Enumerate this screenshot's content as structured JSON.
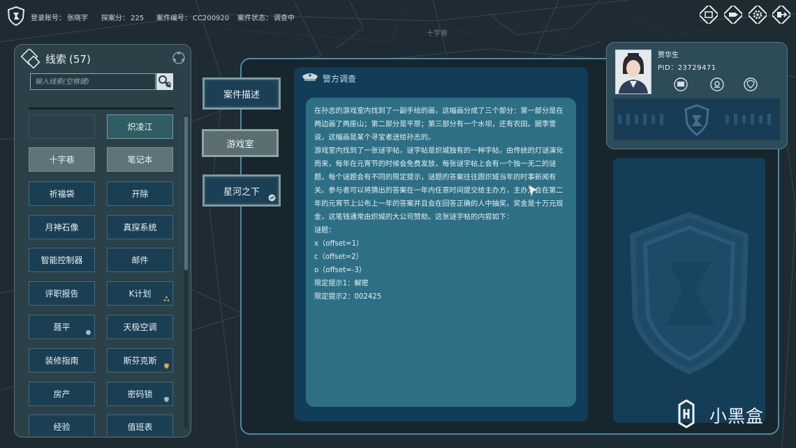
{
  "topbar": {
    "account_label": "登录账号：",
    "account": "张晓宇",
    "score_label": "探案分：",
    "score": "225",
    "case_no_label": "案件编号：",
    "case_no": "CC200920",
    "status_label": "案件状态：",
    "status": "调查中",
    "buttons": [
      "window-icon",
      "tag-icon",
      "gear-icon",
      "exit-icon"
    ]
  },
  "map": {
    "street_label": "十字巷"
  },
  "clues": {
    "title": "线索",
    "count": "(57)",
    "search_placeholder": "输入线索(空格键)",
    "items": [
      {
        "label": "",
        "style": "empty"
      },
      {
        "label": "炽凌江",
        "style": "teal"
      },
      {
        "label": "十字巷",
        "style": "gray"
      },
      {
        "label": "笔记本",
        "style": "gray"
      },
      {
        "label": "祈福袋",
        "style": "blue"
      },
      {
        "label": "开除",
        "style": "blue"
      },
      {
        "label": "月神石像",
        "style": "blue"
      },
      {
        "label": "真探系统",
        "style": "blue"
      },
      {
        "label": "智能控制器",
        "style": "blue"
      },
      {
        "label": "邮件",
        "style": "blue"
      },
      {
        "label": "评职报告",
        "style": "blue"
      },
      {
        "label": "K计划",
        "style": "blue",
        "badge": "gold-dots"
      },
      {
        "label": "聂平",
        "style": "blue",
        "badge": "gray-dot"
      },
      {
        "label": "天极空调",
        "style": "blue"
      },
      {
        "label": "装修指南",
        "style": "blue"
      },
      {
        "label": "斯芬克斯",
        "style": "blue",
        "badge": "gold-shield"
      },
      {
        "label": "房产",
        "style": "blue"
      },
      {
        "label": "密码锁",
        "style": "blue",
        "badge": "gray-shield"
      },
      {
        "label": "经验",
        "style": "blue"
      },
      {
        "label": "值班表",
        "style": "blue"
      }
    ]
  },
  "tabs": [
    {
      "label": "案件描述",
      "active": false
    },
    {
      "label": "游戏室",
      "active": true
    },
    {
      "label": "星河之下",
      "active": false
    }
  ],
  "document": {
    "header": "警方调查",
    "paragraphs": [
      "在孙志的游戏室内找到了一副手绘的画，这幅画分成了三个部分：第一部分是在两边画了两座山；第二部分是平原；第三部分有一个水坝，还有农田。据李雪说，这幅画是某个寻宝者送给孙志的。",
      "游戏室内找到了一张谜字帖，谜字帖是炽城独有的一种字帖，由传统的灯谜演化而来，每年在元宵节的时候会免费发放，每张谜字帖上会有一个独一无二的谜题，每个谜题会有不同的限定提示，谜题的答案往往跟炽城当年的时事新闻有关。参与者可以将猜出的答案在一年内任意时间提交给主办方，主办方会在第二年的元宵节上公布上一年的答案并且会在回答正确的人中抽奖，奖金是十万元现金，这笔钱通常由炽城的大公司赞助。这张谜字帖的内容如下：",
      "谜题：",
      "x（offset=1）",
      "c（offset=2）",
      "o（offset=-3）",
      "限定提示1：解密",
      "限定提示2：002425"
    ]
  },
  "profile": {
    "name": "贾华生",
    "pid_label": "PID：",
    "pid": "23729471"
  },
  "watermark": {
    "text": "小黑盒"
  }
}
